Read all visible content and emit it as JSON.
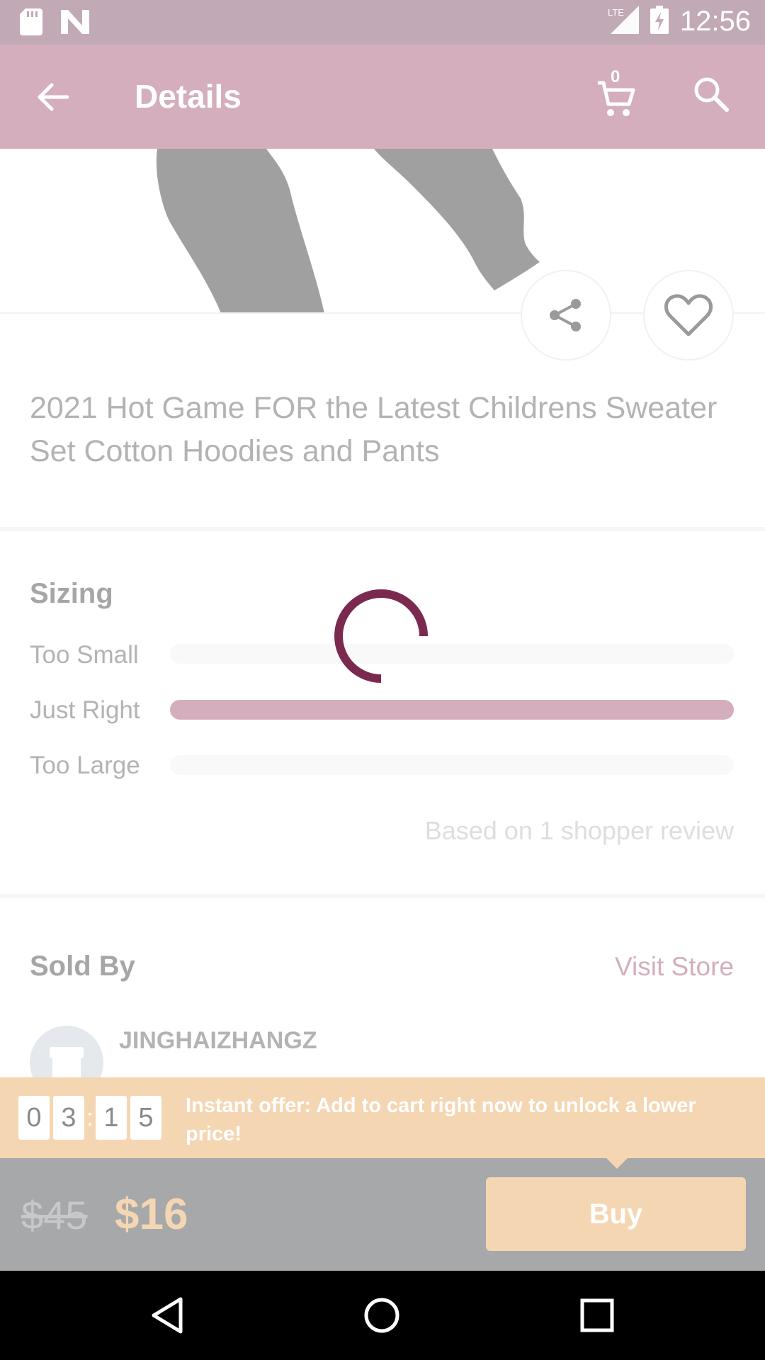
{
  "status_bar": {
    "time": "12:56",
    "network": "LTE",
    "icons": [
      "sd-card-icon",
      "n-notification-icon",
      "lte-signal-icon",
      "battery-charging-icon"
    ]
  },
  "app_bar": {
    "title": "Details",
    "cart_count": "0",
    "icons": [
      "back-arrow-icon",
      "cart-icon",
      "search-icon"
    ]
  },
  "product": {
    "title": "2021 Hot Game FOR the Latest Childrens Sweater Set Cotton Hoodies and Pants",
    "actions": [
      "share-icon",
      "heart-icon"
    ]
  },
  "sizing": {
    "heading": "Sizing",
    "rows": [
      {
        "label": "Too Small",
        "fraction": 0.0
      },
      {
        "label": "Just Right",
        "fraction": 1.0
      },
      {
        "label": "Too Large",
        "fraction": 0.0
      }
    ],
    "review_note": "Based on 1 shopper review"
  },
  "seller": {
    "heading": "Sold By",
    "visit_store": "Visit Store",
    "store_name": "JINGHAIZHANGZ"
  },
  "offer": {
    "timer_digits": [
      "0",
      "3",
      "1",
      "5"
    ],
    "separator": ":",
    "text": "Instant offer: Add to cart right now to unlock a lower price!"
  },
  "buy_bar": {
    "old_price": "$45",
    "new_price": "$16",
    "buy_label": "Buy"
  },
  "colors": {
    "brand_pink": "#d4aebd",
    "spinner": "#7b2a4f",
    "offer_peach": "#f5d6b3",
    "overlay_gray": "#a6a8aa"
  }
}
